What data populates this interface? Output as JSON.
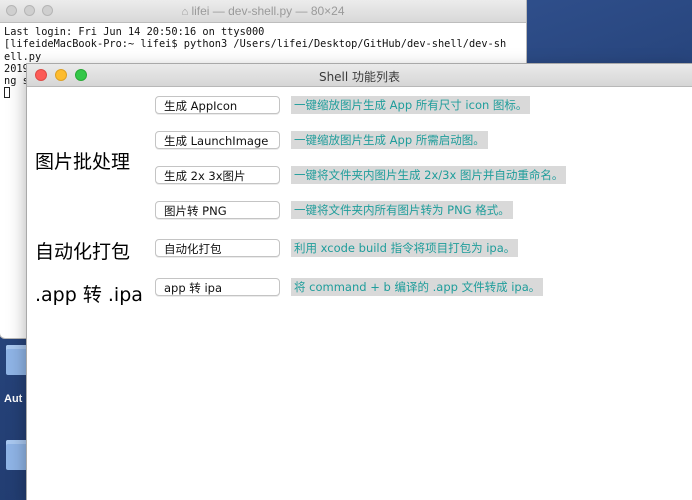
{
  "terminal": {
    "title": "lifei — dev-shell.py — 80×24",
    "lines": [
      "Last login: Fri Jun 14 20:50:16 on ttys000",
      "[lifeideMacBook-Pro:~ lifei$ python3 /Users/lifei/Desktop/GitHub/dev-shell/dev-sh",
      "ell.py",
      "2019",
      "ng s"
    ]
  },
  "desktop": {
    "label": "Aut"
  },
  "shell": {
    "title": "Shell 功能列表",
    "colors": {
      "close": "#fc5b57",
      "minimize": "#fdbc2e",
      "zoom": "#33c748",
      "desc_text": "#1f9d9b"
    },
    "categories": [
      {
        "label": "图片批处理"
      },
      {
        "label": "自动化打包"
      },
      {
        "label": ".app 转 .ipa"
      }
    ],
    "actions": [
      {
        "button": "生成 AppIcon",
        "desc": "一键缩放图片生成 App 所有尺寸 icon 图标。"
      },
      {
        "button": "生成 LaunchImage",
        "desc": "一键缩放图片生成 App 所需启动图。"
      },
      {
        "button": "生成 2x 3x图片",
        "desc": "一键将文件夹内图片生成 2x/3x 图片并自动重命名。"
      },
      {
        "button": "图片转 PNG",
        "desc": "一键将文件夹内所有图片转为 PNG 格式。"
      },
      {
        "button": "自动化打包",
        "desc": "利用 xcode build 指令将项目打包为 ipa。"
      },
      {
        "button": "app 转 ipa",
        "desc": "将 command + b 编译的 .app 文件转成 ipa。"
      }
    ]
  }
}
